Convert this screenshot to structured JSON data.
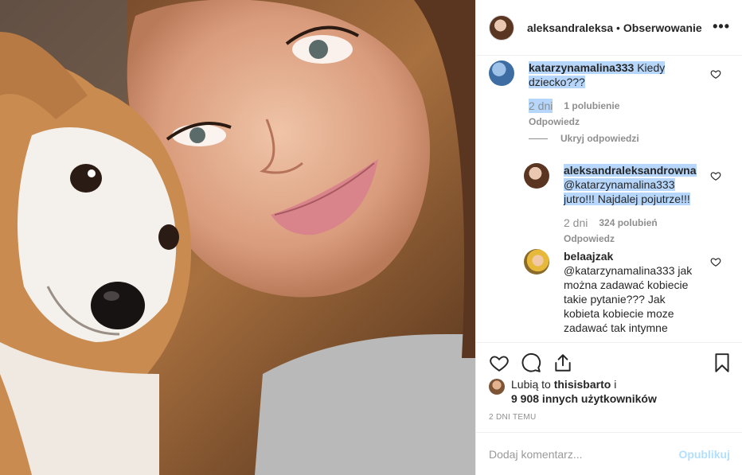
{
  "header": {
    "username": "aleksandraleksandrowna",
    "dot": "•",
    "follow_label": "Obserwowanie",
    "more_icon": "more-icon"
  },
  "comments": [
    {
      "username": "katarzynamalina333",
      "text": "Kiedy dziecko???",
      "time": "2 dni",
      "likes": "1 polubienie",
      "reply_label": "Odpowiedz"
    },
    {
      "username": "aleksandraleksandrowna",
      "mention": "@katarzynamalina333",
      "text": "jutro!!! Najdalej pojutrze!!!",
      "time": "2 dni",
      "likes": "324 polubień",
      "reply_label": "Odpowiedz"
    },
    {
      "username": "belaajzak",
      "mention": "@katarzynamalina333",
      "text": "jak można zadawać kobiecie takie pytanie??? Jak kobieta kobiecie moze zadawać tak intymne"
    }
  ],
  "hide_replies_label": "Ukryj odpowiedzi",
  "likes": {
    "prefix": "Lubią to",
    "user": "thisisbarto",
    "conj": "i",
    "others": "9 908 innych użytkowników"
  },
  "date": "2 DNI TEMU",
  "add_comment": {
    "placeholder": "Dodaj komentarz...",
    "publish_label": "Opublikuj"
  },
  "colors": {
    "text": "#262626",
    "secondary": "#8e8e8e",
    "selection": "#b6d7fb",
    "publish_disabled": "#b2dffc",
    "border": "#efefef"
  }
}
